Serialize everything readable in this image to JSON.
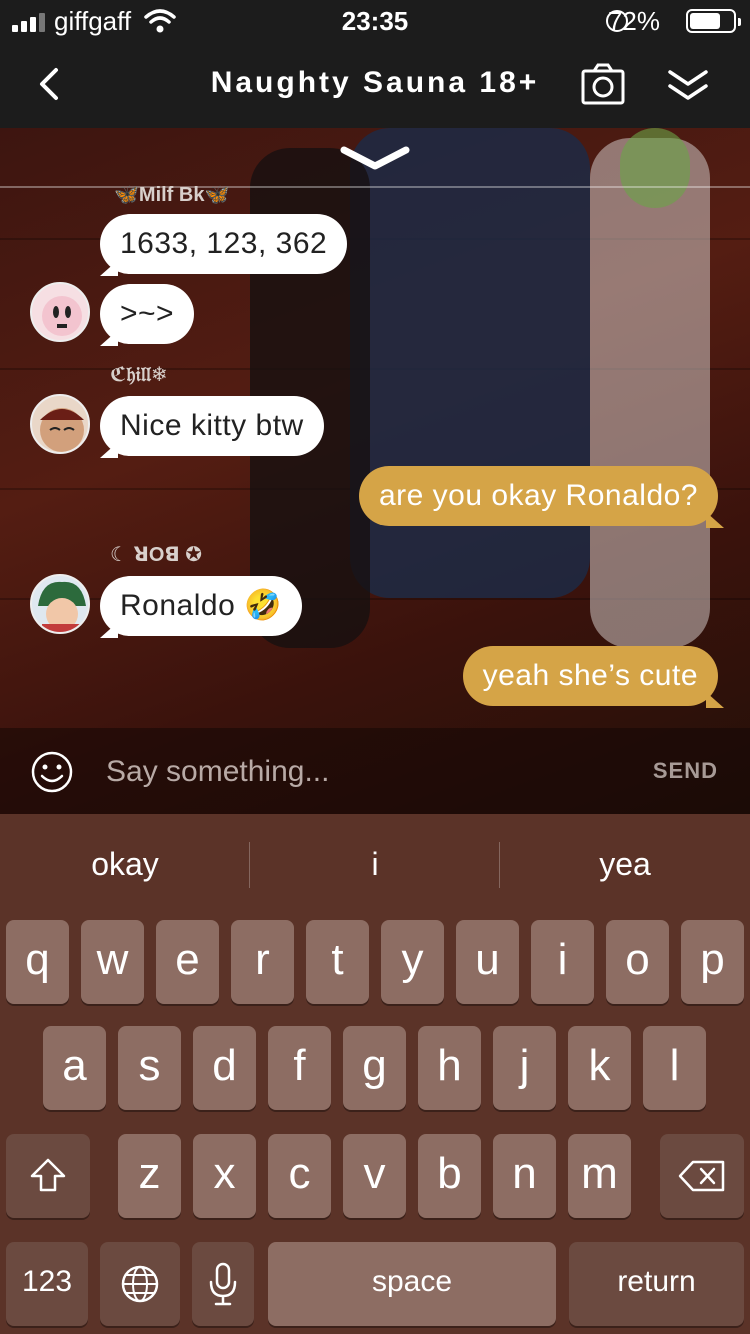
{
  "status_bar": {
    "carrier": "giffgaff",
    "time": "23:35",
    "battery_text": "72%",
    "battery_level": 0.72
  },
  "nav": {
    "title": "Naughty Sauna 18+"
  },
  "messages": [
    {
      "sender": "🦋Milf Bk🦋",
      "text": "1633, 123, 362"
    },
    {
      "sender": "",
      "text": ">~>"
    },
    {
      "sender": "ℭ𝔥𝔦𝔩𝔩❄",
      "text": "Nice kitty btw"
    },
    {
      "sender": "",
      "text": "are you okay Ronaldo?",
      "mine": true
    },
    {
      "sender": "☾ ꓤOꓭ ✪",
      "text": "Ronaldo 🤣"
    },
    {
      "sender": "",
      "text": "yeah she’s cute",
      "mine": true
    }
  ],
  "composer": {
    "placeholder": "Say something...",
    "send_label": "SEND"
  },
  "keyboard": {
    "suggestions": [
      "okay",
      "i",
      "yea"
    ],
    "row1": [
      "q",
      "w",
      "e",
      "r",
      "t",
      "y",
      "u",
      "i",
      "o",
      "p"
    ],
    "row2": [
      "a",
      "s",
      "d",
      "f",
      "g",
      "h",
      "j",
      "k",
      "l"
    ],
    "row3": [
      "z",
      "x",
      "c",
      "v",
      "b",
      "n",
      "m"
    ],
    "numbers_label": "123",
    "space_label": "space",
    "return_label": "return"
  },
  "colors": {
    "my_bubble": "#d5a447",
    "their_bubble": "#ffffff",
    "keyboard": "#5b3328"
  }
}
